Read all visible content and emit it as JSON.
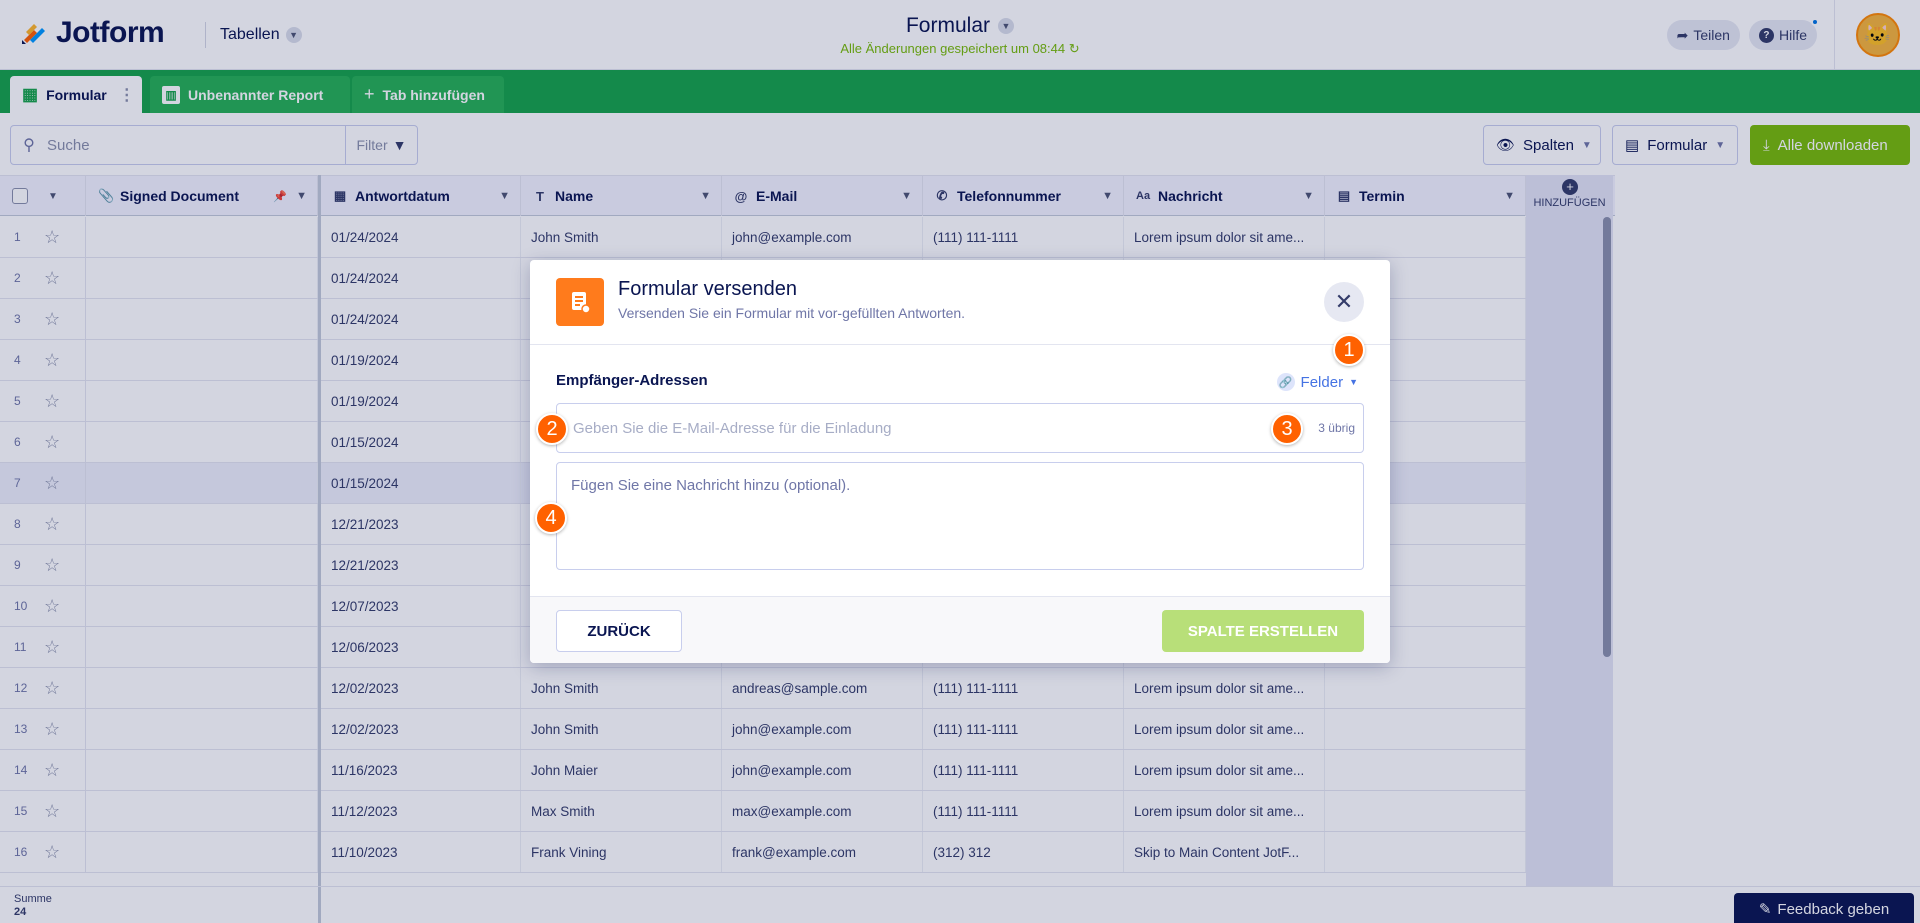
{
  "header": {
    "brand": "Jotform",
    "tables_label": "Tabellen",
    "form_title": "Formular",
    "save_status": "Alle Änderungen gespeichert um 08:44",
    "share_label": "Teilen",
    "help_label": "Hilfe"
  },
  "tabs": [
    {
      "label": "Formular",
      "icon": "table-icon"
    },
    {
      "label": "Unbenannter Report",
      "icon": "report-icon"
    },
    {
      "label": "Tab hinzufügen",
      "icon": "plus-icon"
    }
  ],
  "toolbar": {
    "search_placeholder": "Suche",
    "filter_label": "Filter",
    "columns_label": "Spalten",
    "form_label": "Formular",
    "download_label": "Alle downloaden"
  },
  "columns": [
    {
      "label": "Signed Document",
      "icon": "paperclip-icon"
    },
    {
      "label": "Antwortdatum",
      "icon": "calendar-icon"
    },
    {
      "label": "Name",
      "icon": "text-icon"
    },
    {
      "label": "E-Mail",
      "icon": "at-icon"
    },
    {
      "label": "Telefonnummer",
      "icon": "phone-icon"
    },
    {
      "label": "Nachricht",
      "icon": "font-icon"
    },
    {
      "label": "Termin",
      "icon": "appointment-icon"
    }
  ],
  "add_column_label": "HINZUFÜGEN",
  "rows": [
    {
      "n": "1",
      "date": "01/24/2024",
      "name": "John Smith",
      "email": "john@example.com",
      "phone": "(111) 111-1111",
      "msg": "Lorem ipsum dolor sit ame..."
    },
    {
      "n": "2",
      "date": "01/24/2024",
      "name": "",
      "email": "",
      "phone": "",
      "msg": ""
    },
    {
      "n": "3",
      "date": "01/24/2024",
      "name": "",
      "email": "",
      "phone": "",
      "msg": ""
    },
    {
      "n": "4",
      "date": "01/19/2024",
      "name": "",
      "email": "",
      "phone": "",
      "msg": ""
    },
    {
      "n": "5",
      "date": "01/19/2024",
      "name": "",
      "email": "",
      "phone": "",
      "msg": ""
    },
    {
      "n": "6",
      "date": "01/15/2024",
      "name": "",
      "email": "",
      "phone": "",
      "msg": ""
    },
    {
      "n": "7",
      "date": "01/15/2024",
      "name": "",
      "email": "",
      "phone": "",
      "msg": ""
    },
    {
      "n": "8",
      "date": "12/21/2023",
      "name": "",
      "email": "",
      "phone": "",
      "msg": ""
    },
    {
      "n": "9",
      "date": "12/21/2023",
      "name": "",
      "email": "",
      "phone": "",
      "msg": ""
    },
    {
      "n": "10",
      "date": "12/07/2023",
      "name": "",
      "email": "",
      "phone": "",
      "msg": ""
    },
    {
      "n": "11",
      "date": "12/06/2023",
      "name": "",
      "email": "",
      "phone": "",
      "msg": ""
    },
    {
      "n": "12",
      "date": "12/02/2023",
      "name": "John Smith",
      "email": "andreas@sample.com",
      "phone": "(111) 111-1111",
      "msg": "Lorem ipsum dolor sit ame..."
    },
    {
      "n": "13",
      "date": "12/02/2023",
      "name": "John Smith",
      "email": "john@example.com",
      "phone": "(111) 111-1111",
      "msg": "Lorem ipsum dolor sit ame..."
    },
    {
      "n": "14",
      "date": "11/16/2023",
      "name": "John Maier",
      "email": "john@example.com",
      "phone": "(111) 111-1111",
      "msg": "Lorem ipsum dolor sit ame..."
    },
    {
      "n": "15",
      "date": "11/12/2023",
      "name": "Max Smith",
      "email": "max@example.com",
      "phone": "(111) 111-1111",
      "msg": "Lorem ipsum dolor sit ame..."
    },
    {
      "n": "16",
      "date": "11/10/2023",
      "name": "Frank Vining",
      "email": "frank@example.com",
      "phone": "(312) 312",
      "msg": "Skip to Main Content JotF..."
    }
  ],
  "footer": {
    "sum_label": "Summe",
    "sum_value": "24",
    "feedback_label": "Feedback geben"
  },
  "modal": {
    "title": "Formular versenden",
    "subtitle": "Versenden Sie ein Formular mit vor-gefüllten Antworten.",
    "recipients_label": "Empfänger-Adressen",
    "fields_label": "Felder",
    "email_placeholder": "Geben Sie die E-Mail-Adresse für die Einladung",
    "remaining": "3 übrig",
    "message_placeholder": "Fügen Sie eine Nachricht hinzu (optional).",
    "back_label": "ZURÜCK",
    "create_label": "SPALTE ERSTELLEN"
  },
  "badges": [
    "1",
    "2",
    "3",
    "4"
  ],
  "colors": {
    "brand_green": "#17a44a",
    "download_green": "#78bb07",
    "badge_orange": "#ff6100",
    "navy": "#0a1551"
  }
}
